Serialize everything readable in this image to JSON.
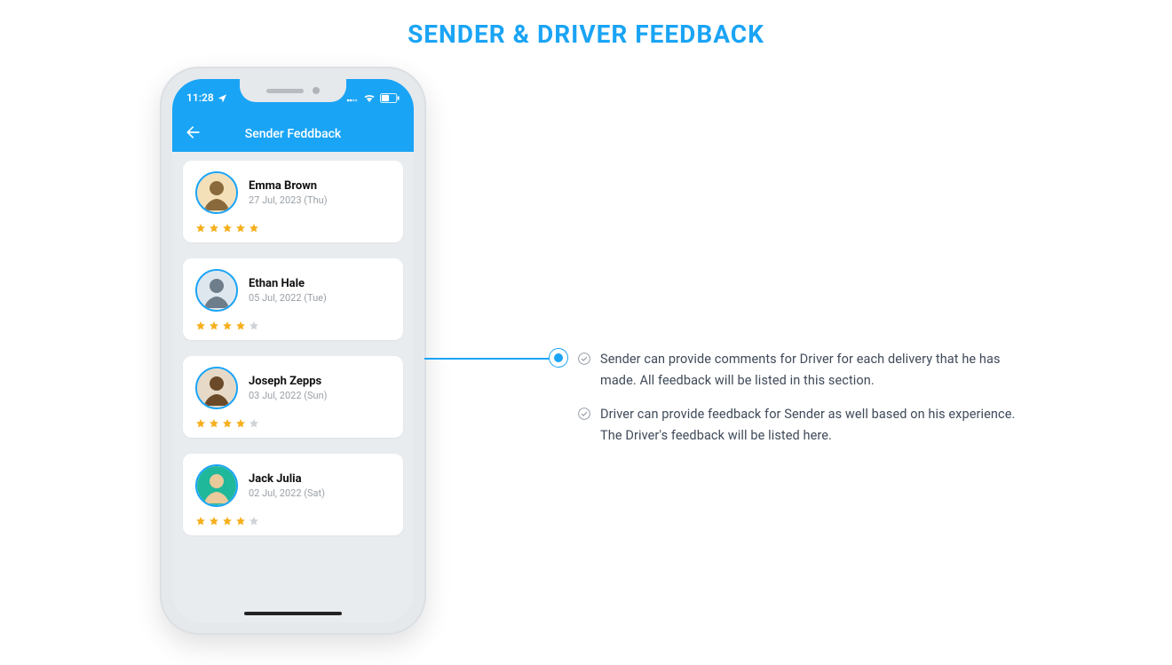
{
  "page_heading": "SENDER & DRIVER FEEDBACK",
  "phone": {
    "status_time": "11:28",
    "nav_title": "Sender Feddback"
  },
  "feedback": [
    {
      "name": "Emma Brown",
      "date": "27 Jul, 2023 (Thu)",
      "rating": 5,
      "avatar_bg": "#f3dfb8",
      "avatar_fg": "#8a6a3c"
    },
    {
      "name": "Ethan Hale",
      "date": "05 Jul, 2022 (Tue)",
      "rating": 4,
      "avatar_bg": "#dfe7ee",
      "avatar_fg": "#6e7d8a"
    },
    {
      "name": "Joseph Zepps",
      "date": "03 Jul, 2022 (Sun)",
      "rating": 4,
      "avatar_bg": "#e6d9c7",
      "avatar_fg": "#6b4a2a"
    },
    {
      "name": "Jack Julia",
      "date": "02 Jul, 2022 (Sat)",
      "rating": 4,
      "avatar_bg": "#1fb89a",
      "avatar_fg": "#eac99a"
    }
  ],
  "bullets": [
    "Sender can provide comments for Driver for each delivery that he has made. All feedback will be listed in this section.",
    "Driver can provide feedback for Sender as well based on his experience. The Driver's feedback will be listed here."
  ]
}
